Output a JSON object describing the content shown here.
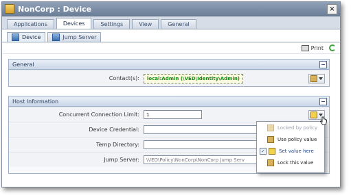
{
  "window": {
    "title": "NonCorp : Device",
    "close_glyph": "×"
  },
  "tabs_primary": [
    {
      "label": "Applications"
    },
    {
      "label": "Devices"
    },
    {
      "label": "Settings"
    },
    {
      "label": "View"
    },
    {
      "label": "General"
    }
  ],
  "tabs_secondary": [
    {
      "label": "Device"
    },
    {
      "label": "Jump Server"
    }
  ],
  "toolbar": {
    "print_label": "Print"
  },
  "general": {
    "title": "General",
    "contacts_label": "Contact(s):",
    "contacts_value": "local:Admin (\\VED\\Identity\\Admin)"
  },
  "host": {
    "title": "Host Information",
    "rows": [
      {
        "label": "Concurrent Connection Limit:",
        "value": "1"
      },
      {
        "label": "Device Credential:",
        "value": ""
      },
      {
        "label": "Temp Directory:",
        "value": ""
      },
      {
        "label": "Jump Server:",
        "value": "\\VED\\Policy\\NonCorp\\NonCorp Jump Serv"
      }
    ]
  },
  "policy_menu": {
    "items": [
      {
        "label": "Locked by policy",
        "state": "disabled"
      },
      {
        "label": "Use policy value",
        "state": "normal"
      },
      {
        "label": "Set value here",
        "state": "selected",
        "check_glyph": "✓"
      },
      {
        "label": "Lock this value",
        "state": "normal"
      }
    ]
  }
}
